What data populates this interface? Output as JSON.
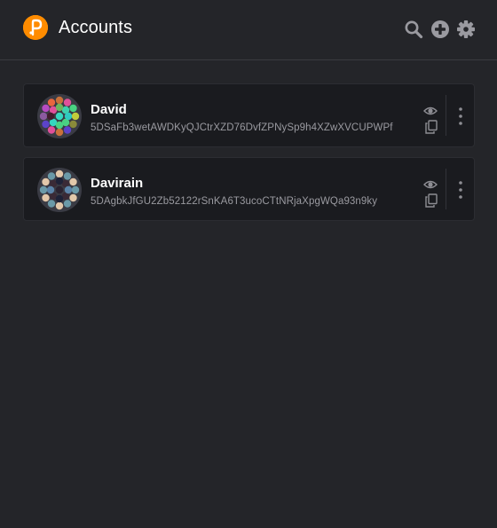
{
  "header": {
    "title": "Accounts",
    "icons": [
      "logo-icon",
      "search-icon",
      "add-icon",
      "settings-icon"
    ]
  },
  "accounts": [
    {
      "name": "David",
      "address": "5DSaFb3wetAWDKyQJCtrXZD76DvfZPNySp9h4XZwXVCUPWPf",
      "identicon_colors": [
        "#e0509a",
        "#8b5a9f",
        "#3ecfae",
        "#c2cc3a",
        "#c9713a",
        "#e8663f",
        "#49d282",
        "#5c43c9",
        "#35d7bf"
      ]
    },
    {
      "name": "Davirain",
      "address": "5DAgbkJfGU2Zb52122rSnKA6T3ucoCTtNRjaXpgWQa93n9ky",
      "identicon_colors": [
        "#e3c8aa",
        "#6b9aa8",
        "#3a2a36",
        "#1e2238",
        "#5b83a8"
      ]
    }
  ],
  "colors": {
    "background": "#242529",
    "card": "#1a1b1f",
    "accent": "#ff8c00",
    "text": "#ffffff",
    "muted": "#9a9aa0"
  }
}
